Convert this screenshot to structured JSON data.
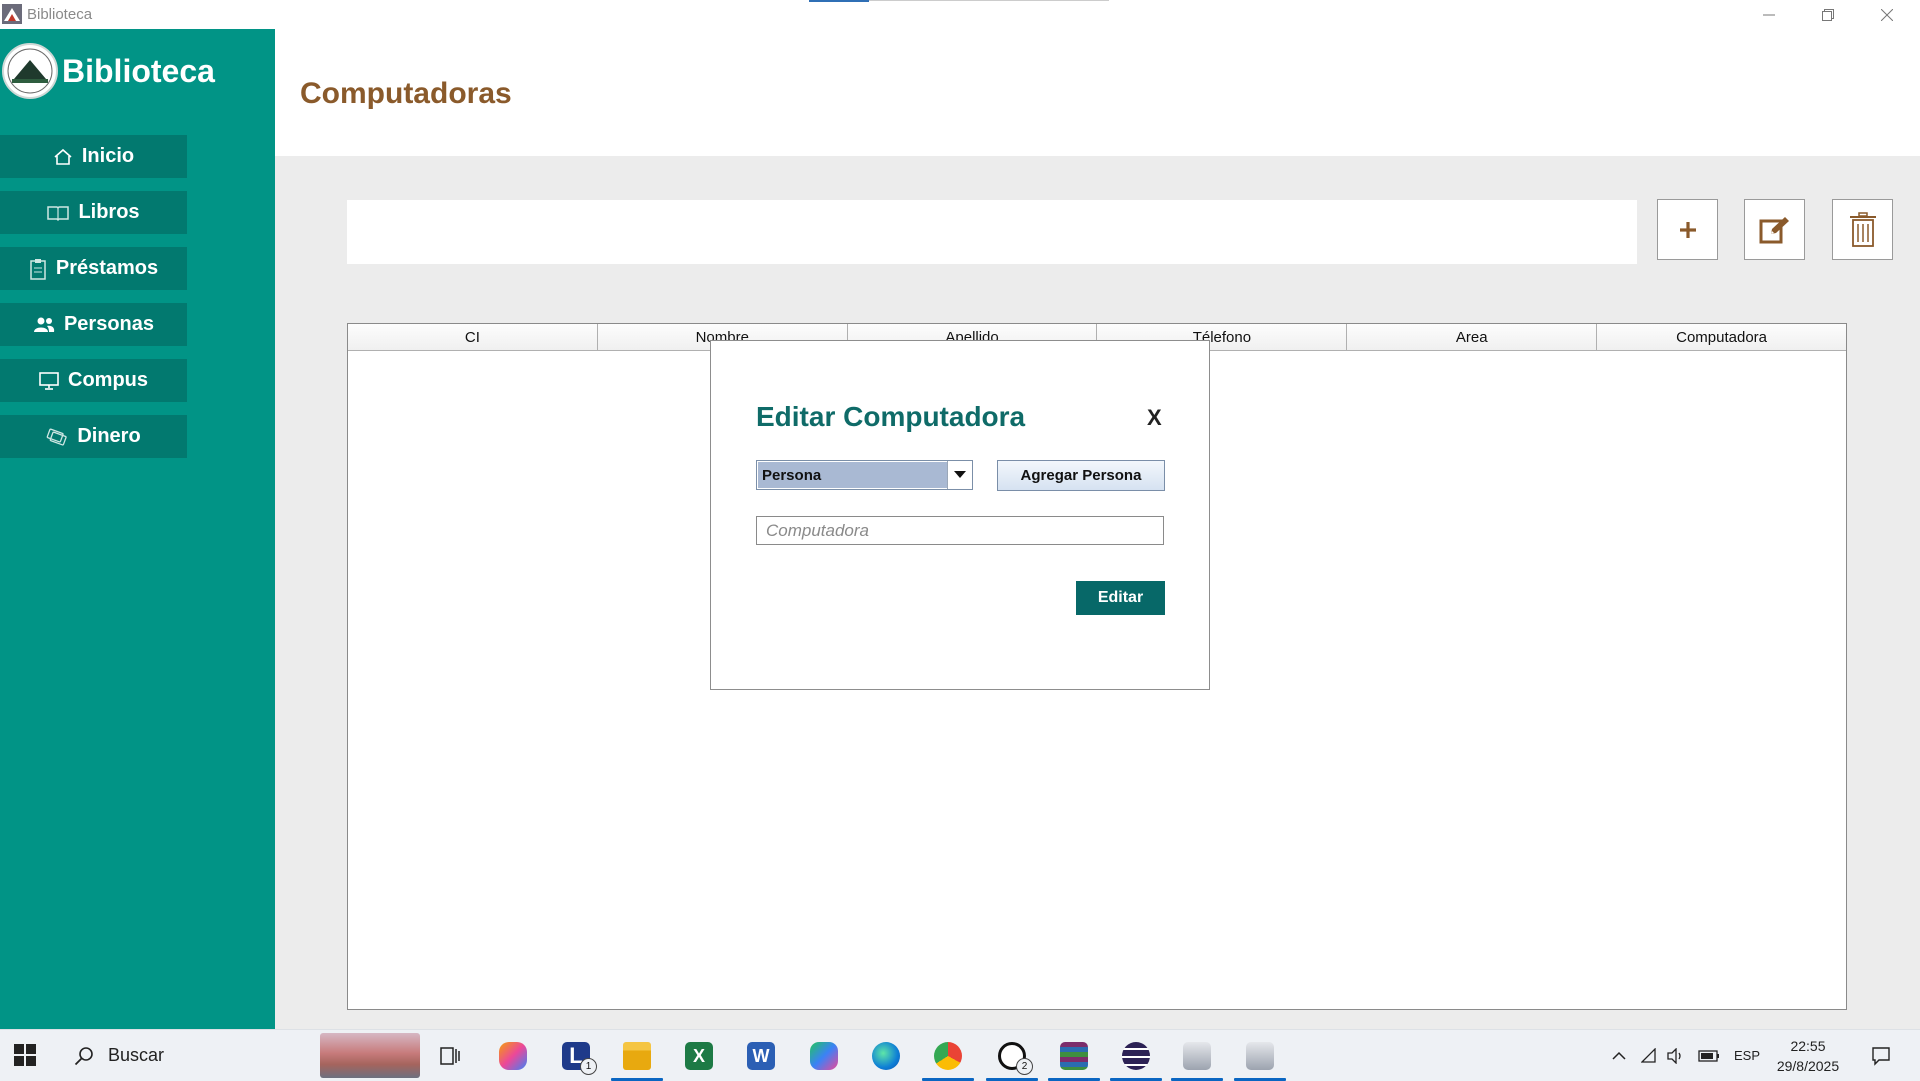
{
  "window": {
    "title": "Biblioteca"
  },
  "sidebar": {
    "brand": "Biblioteca",
    "items": [
      {
        "label": "Inicio",
        "icon": "home-icon"
      },
      {
        "label": "Libros",
        "icon": "book-icon"
      },
      {
        "label": "Préstamos",
        "icon": "clipboard-icon"
      },
      {
        "label": "Personas",
        "icon": "people-icon"
      },
      {
        "label": "Compus",
        "icon": "monitor-icon"
      },
      {
        "label": "Dinero",
        "icon": "money-icon"
      }
    ]
  },
  "header": {
    "title": "Computadoras"
  },
  "toolbar": {
    "search_value": "",
    "add": "plus-icon",
    "edit": "edit-icon",
    "delete": "trash-icon"
  },
  "table": {
    "columns": [
      "CI",
      "Nombre",
      "Apellido",
      "Télefono",
      "Area",
      "Computadora"
    ],
    "rows": []
  },
  "modal": {
    "title": "Editar Computadora",
    "close": "X",
    "persona_selected": "Persona",
    "add_person_label": "Agregar Persona",
    "computer_placeholder": "Computadora",
    "submit_label": "Editar"
  },
  "taskbar": {
    "search_label": "Buscar",
    "lang": "ESP",
    "time": "22:55",
    "date": "29/8/2025",
    "badges": {
      "lenovo": "1",
      "whatsapp": "2"
    }
  },
  "colors": {
    "sidebar": "#019486",
    "nav_item": "#02796f",
    "title_brown": "#8a5a2b",
    "modal_title": "#0f6b68",
    "edit_button": "#076868"
  }
}
